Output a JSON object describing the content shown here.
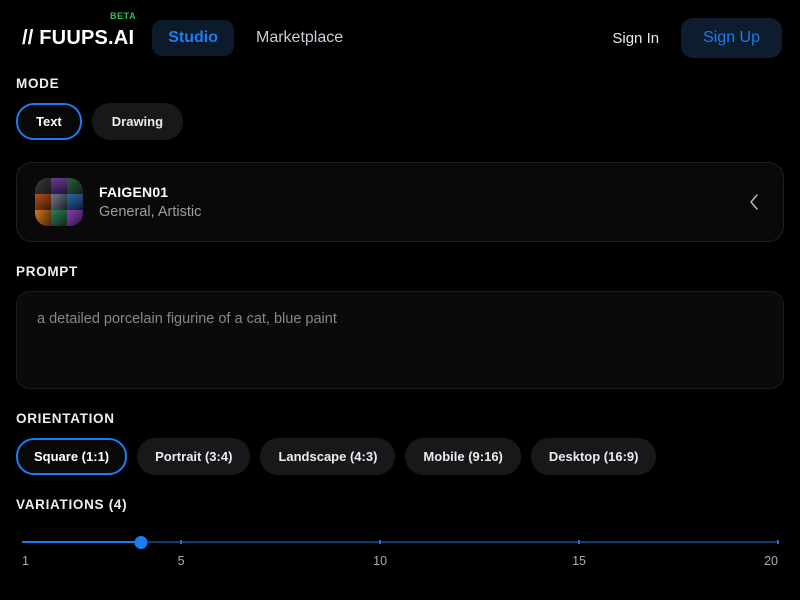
{
  "header": {
    "brand": "// FUUPS.AI",
    "beta_badge": "BETA",
    "tabs": [
      {
        "label": "Studio",
        "active": true
      },
      {
        "label": "Marketplace",
        "active": false
      }
    ],
    "sign_in": "Sign In",
    "sign_up": "Sign Up",
    "accent_color": "#1e7bf0",
    "beta_color": "#22c55e"
  },
  "mode": {
    "label": "MODE",
    "options": [
      {
        "label": "Text",
        "selected": true
      },
      {
        "label": "Drawing",
        "selected": false
      }
    ]
  },
  "model": {
    "name": "FAIGEN01",
    "tags": "General, Artistic",
    "thumbnail_name": "model-collage-thumbnail",
    "collapse_icon": "chevron-left-icon"
  },
  "prompt": {
    "label": "PROMPT",
    "value": "a detailed porcelain figurine of a cat, blue paint",
    "placeholder": "a detailed porcelain figurine of a cat, blue paint"
  },
  "orientation": {
    "label": "ORIENTATION",
    "options": [
      {
        "label": "Square (1:1)",
        "selected": true
      },
      {
        "label": "Portrait (3:4)",
        "selected": false
      },
      {
        "label": "Landscape (4:3)",
        "selected": false
      },
      {
        "label": "Mobile (9:16)",
        "selected": false
      },
      {
        "label": "Desktop (16:9)",
        "selected": false
      }
    ]
  },
  "variations": {
    "label": "VARIATIONS (4)",
    "value": 4,
    "min": 1,
    "max": 20,
    "scale_labels": [
      "1",
      "5",
      "10",
      "15",
      "20"
    ],
    "track_color": "#1a7ef2",
    "track_inactive_color": "#143a6b"
  }
}
